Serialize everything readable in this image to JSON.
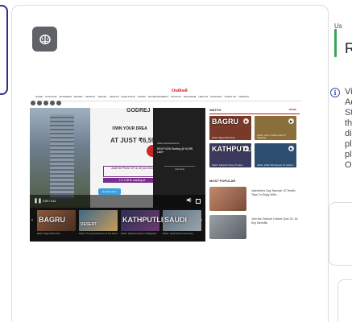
{
  "colors": {
    "accent_red": "#c4161c",
    "status_green": "#3ba55d",
    "info_blue": "#3b55a3",
    "icon_button_bg": "#5f6368",
    "ad_purple": "#7b2c8f"
  },
  "toolbar": {
    "brain_icon": "brain-icon"
  },
  "site": {
    "logo": "Outlook",
    "nav": [
      "HOME",
      "OUTLOOK",
      "BUSINESS",
      "MONEY",
      "SPORTS",
      "TRAVEL",
      "CRAFTS",
      "ELECTIONS",
      "ASTRO",
      "ENTERTAINMENT",
      "PHOTOS",
      "MAGAZINE",
      "HEALTH",
      "PODCAST",
      "START UP",
      "OPINION"
    ]
  },
  "player": {
    "ad_title": "GODREJ",
    "ad_headline": "OWN YOUR DREA",
    "ad_price": "AT JUST ₹6,599",
    "ad_box_text": "Avail the iPhone 15* on all your drea",
    "ad_strip": "2 & 3 BHK starting at",
    "ad_tag": "Enquire Now",
    "video_label": "Video Advertisement",
    "video_text": "RSVP NOW Starting @ ₹6,599 Lakh*",
    "video_button": "Ask Now",
    "timecode": "0:00 / 0:41"
  },
  "strip": {
    "items": [
      {
        "title": "BAGRU",
        "caption": "Watch: Bagru Block Print"
      },
      {
        "title": "DESERT",
        "caption": "Watch: The Last Fisherman Of The Desert"
      },
      {
        "title": "KATHPUTLI",
        "caption": "Watch: Kathputli Artisans Of Rajasthan"
      },
      {
        "title": "SAUDI",
        "caption": "Watch: Saudi Arabia Travel Diary"
      }
    ]
  },
  "sidebar": {
    "watch_header": "WATCH",
    "more_label": "MORE",
    "watch_items": [
      {
        "title": "BAGRU",
        "caption": "Watch: Bagru Block Print",
        "color": "#7a3a2a"
      },
      {
        "title": "",
        "caption": "Watch: Life in Pushkar Mela Of Rajasthan",
        "color": "#8a6f3a"
      },
      {
        "title": "KATHPUTLI",
        "caption": "Watch: Kathputli Colony Of Jaipur",
        "color": "#3b3a5e"
      },
      {
        "title": "",
        "caption": "Watch: Indian Silk Weavers Of Jodhpur",
        "color": "#2c4d6e"
      }
    ],
    "most_popular_header": "MOST POPULAR",
    "popular": [
      {
        "text": "Valentine's Day Special: 10 Terrific Trips To Enjoy With...",
        "color": "#b0705a"
      },
      {
        "text": "Join the Outlook Cricket Quiz 14: 15 Key Benefits",
        "color": "#7a7f86"
      }
    ]
  },
  "right_panel": {
    "top_label": "Us",
    "top_letter": "R",
    "info_icon": "info-icon",
    "info_lines": [
      "Vi",
      "Ad",
      "St",
      "th",
      "di",
      "pl",
      "pl",
      "Oa"
    ]
  }
}
